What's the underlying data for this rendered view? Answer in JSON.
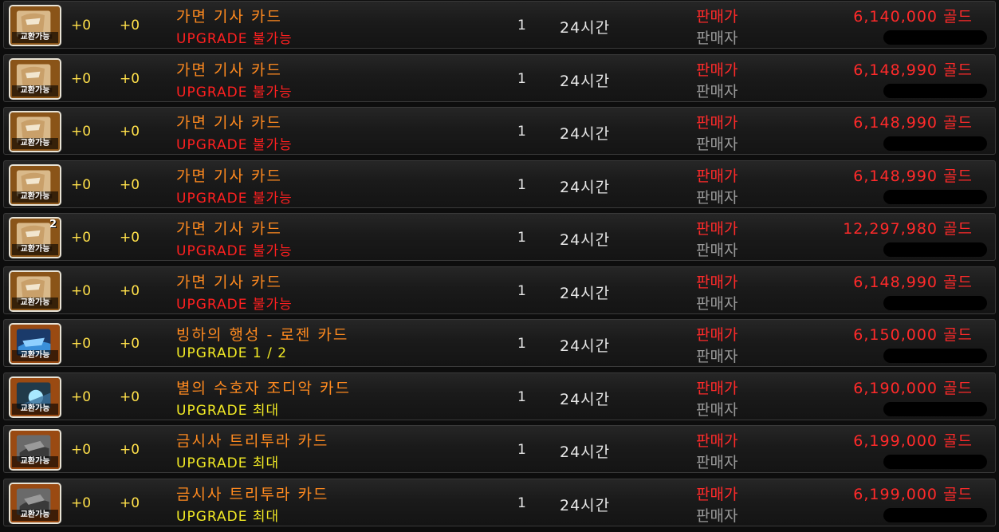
{
  "labels": {
    "sale_price": "판매가",
    "seller": "판매자",
    "tradeable": "교환가능"
  },
  "listings": [
    {
      "icon": "masked-knight-card-icon",
      "enh1": "+0",
      "enh2": "+0",
      "name": "가면 기사 카드",
      "upgrade": "UPGRADE 불가능",
      "upgrade_color": "red",
      "qty": "1",
      "duration": "24시간",
      "price": "6,140,000 골드",
      "stack": ""
    },
    {
      "icon": "masked-knight-card-icon",
      "enh1": "+0",
      "enh2": "+0",
      "name": "가면 기사 카드",
      "upgrade": "UPGRADE 불가능",
      "upgrade_color": "red",
      "qty": "1",
      "duration": "24시간",
      "price": "6,148,990 골드",
      "stack": ""
    },
    {
      "icon": "masked-knight-card-icon",
      "enh1": "+0",
      "enh2": "+0",
      "name": "가면 기사 카드",
      "upgrade": "UPGRADE 불가능",
      "upgrade_color": "red",
      "qty": "1",
      "duration": "24시간",
      "price": "6,148,990 골드",
      "stack": ""
    },
    {
      "icon": "masked-knight-card-icon",
      "enh1": "+0",
      "enh2": "+0",
      "name": "가면 기사 카드",
      "upgrade": "UPGRADE 불가능",
      "upgrade_color": "red",
      "qty": "1",
      "duration": "24시간",
      "price": "6,148,990 골드",
      "stack": ""
    },
    {
      "icon": "masked-knight-card-icon",
      "enh1": "+0",
      "enh2": "+0",
      "name": "가면 기사 카드",
      "upgrade": "UPGRADE 불가능",
      "upgrade_color": "red",
      "qty": "1",
      "duration": "24시간",
      "price": "12,297,980 골드",
      "stack": "2"
    },
    {
      "icon": "masked-knight-card-icon",
      "enh1": "+0",
      "enh2": "+0",
      "name": "가면 기사 카드",
      "upgrade": "UPGRADE 불가능",
      "upgrade_color": "red",
      "qty": "1",
      "duration": "24시간",
      "price": "6,148,990 골드",
      "stack": ""
    },
    {
      "icon": "rozen-card-icon",
      "enh1": "+0",
      "enh2": "+0",
      "name": "빙하의 행성 - 로젠 카드",
      "upgrade": "UPGRADE 1 / 2",
      "upgrade_color": "yellow",
      "qty": "1",
      "duration": "24시간",
      "price": "6,150,000 골드",
      "stack": ""
    },
    {
      "icon": "zodiac-card-icon",
      "enh1": "+0",
      "enh2": "+0",
      "name": "별의 수호자 조디악 카드",
      "upgrade": "UPGRADE 최대",
      "upgrade_color": "yellow",
      "qty": "1",
      "duration": "24시간",
      "price": "6,190,000 골드",
      "stack": ""
    },
    {
      "icon": "trituera-card-icon",
      "enh1": "+0",
      "enh2": "+0",
      "name": "금시사 트리투라 카드",
      "upgrade": "UPGRADE 최대",
      "upgrade_color": "yellow",
      "qty": "1",
      "duration": "24시간",
      "price": "6,199,000 골드",
      "stack": ""
    },
    {
      "icon": "trituera-card-icon",
      "enh1": "+0",
      "enh2": "+0",
      "name": "금시사 트리투라 카드",
      "upgrade": "UPGRADE 최대",
      "upgrade_color": "yellow",
      "qty": "1",
      "duration": "24시간",
      "price": "6,199,000 골드",
      "stack": ""
    }
  ]
}
